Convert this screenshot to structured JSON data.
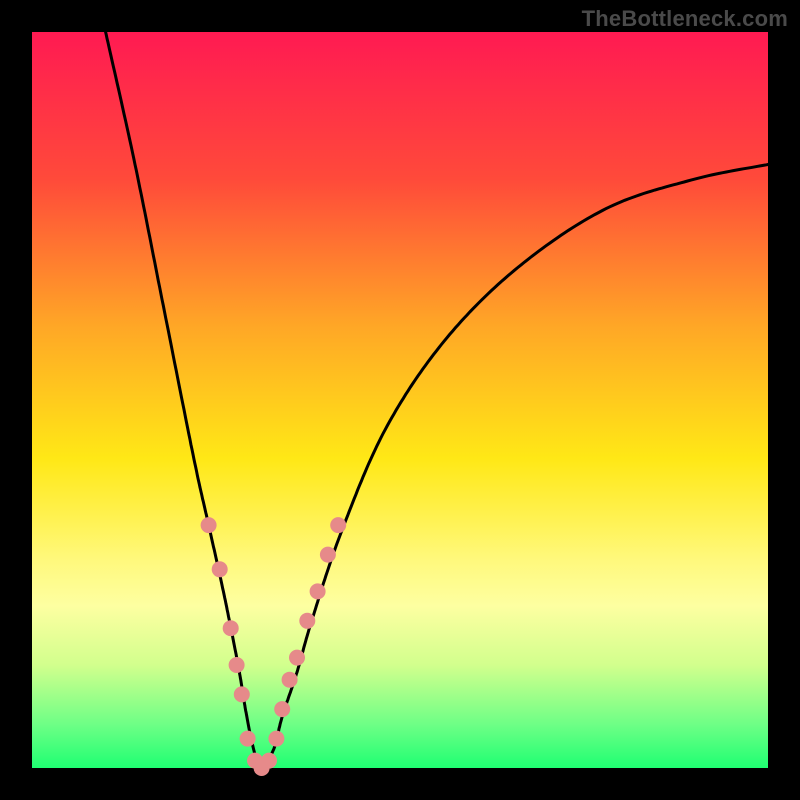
{
  "watermark": "TheBottleneck.com",
  "chart_data": {
    "type": "line",
    "title": "",
    "xlabel": "",
    "ylabel": "",
    "xlim": [
      0,
      100
    ],
    "ylim": [
      0,
      100
    ],
    "grid": false,
    "background_gradient": {
      "type": "vertical",
      "stops": [
        {
          "pos": 0.0,
          "color": "#ff1a52"
        },
        {
          "pos": 0.2,
          "color": "#ff4a3a"
        },
        {
          "pos": 0.4,
          "color": "#ffa726"
        },
        {
          "pos": 0.58,
          "color": "#ffe816"
        },
        {
          "pos": 0.72,
          "color": "#fff97e"
        },
        {
          "pos": 0.78,
          "color": "#fdffa1"
        },
        {
          "pos": 0.86,
          "color": "#d2ff8d"
        },
        {
          "pos": 0.94,
          "color": "#6fff86"
        },
        {
          "pos": 1.0,
          "color": "#1fff72"
        }
      ]
    },
    "series": [
      {
        "name": "bottleneck-curve",
        "description": "Black V-shaped curve; steep descent from top-left, minimum near x≈31 y≈0, rising asymptotically toward right.",
        "x": [
          10,
          14,
          18,
          22,
          24,
          26,
          28,
          29,
          30,
          31,
          32,
          33,
          34,
          36,
          38,
          42,
          48,
          56,
          66,
          78,
          90,
          100
        ],
        "y": [
          100,
          82,
          62,
          42,
          33,
          24,
          14,
          8,
          3,
          0,
          1,
          3,
          7,
          13,
          20,
          32,
          46,
          58,
          68,
          76,
          80,
          82
        ],
        "color": "#000000",
        "stroke_width": 3
      }
    ],
    "markers": {
      "name": "highlight-dots",
      "description": "Soft pink blobs along the lower portion of the V near the minimum.",
      "color": "#e68a8a",
      "radius": 8,
      "points": [
        {
          "x": 24.0,
          "y": 33
        },
        {
          "x": 25.5,
          "y": 27
        },
        {
          "x": 27.0,
          "y": 19
        },
        {
          "x": 27.8,
          "y": 14
        },
        {
          "x": 28.5,
          "y": 10
        },
        {
          "x": 29.3,
          "y": 4
        },
        {
          "x": 30.3,
          "y": 1
        },
        {
          "x": 31.2,
          "y": 0
        },
        {
          "x": 32.2,
          "y": 1
        },
        {
          "x": 33.2,
          "y": 4
        },
        {
          "x": 34.0,
          "y": 8
        },
        {
          "x": 35.0,
          "y": 12
        },
        {
          "x": 36.0,
          "y": 15
        },
        {
          "x": 37.4,
          "y": 20
        },
        {
          "x": 38.8,
          "y": 24
        },
        {
          "x": 40.2,
          "y": 29
        },
        {
          "x": 41.6,
          "y": 33
        }
      ]
    }
  }
}
